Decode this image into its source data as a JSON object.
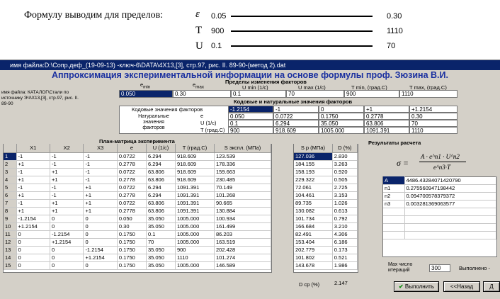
{
  "heading": "Формулу выводим для пределов:",
  "limits": [
    {
      "sym": "ε",
      "min": "0.05",
      "max": "0.30"
    },
    {
      "sym": "T",
      "min": "900",
      "max": "1110"
    },
    {
      "sym": "U",
      "min": "0.1",
      "max": "70"
    }
  ],
  "window": {
    "title": "имя файла:D:\\Сопр.деф_(19-09-13) -ключ-6\\DATA\\4X13,[3], стр.97, рис. II. 89-90-(метод 2).dat",
    "app_title": "Аппроксимация экспериментальной информации на основе формулы проф. Зюзина В.И.",
    "file_label": "имя файла: КАТАЛОГ\\Стали по источнику ЭЧ\\Х13,[3], стр.97, рис. II. 89-90",
    "limits_section": {
      "title": "Пределы изменения факторов",
      "headers": [
        "e min",
        "e max",
        "U min (1/c)",
        "U max (1/c)",
        "T min, (град.С)",
        "T max, (град.С)"
      ],
      "e_min_label": "e",
      "e_min_sub": "min",
      "e_max_label": "e",
      "e_max_sub": "max",
      "u_min_label": "U min (1/c)",
      "u_max_label": "U max (1/c)",
      "t_min_label": "T min, (град.С)",
      "t_max_label": "T max, (град.С)",
      "values": [
        "0.050",
        "0.30",
        "0.1",
        "70",
        "900",
        "1110"
      ]
    },
    "codes_section": {
      "title": "Кодовые и натуральные значения факторов",
      "code_label": "Кодовые значения факторов",
      "codes": [
        "-1.2154",
        "-1",
        "0",
        "+1",
        "+1.2154"
      ],
      "natural_label": "Натуральные значения факторов",
      "rows": [
        {
          "name": "e",
          "vals": [
            "0.050",
            "0.0722",
            "0.1750",
            "0.2778",
            "0.30"
          ]
        },
        {
          "name": "U (1/c)",
          "vals": [
            "0.1",
            "6.294",
            "35.050",
            "63.806",
            "70"
          ]
        },
        {
          "name": "T (град.С)",
          "vals": [
            "900",
            "918.609",
            "1005.000",
            "1091.391",
            "1110"
          ]
        }
      ]
    },
    "plan": {
      "title": "План-матрица эксперимента",
      "headers": [
        "",
        "X1",
        "X2",
        "X3",
        "e",
        "U (1/c)",
        "T (град.С)",
        "S экспл. (МПа)"
      ],
      "rows": [
        [
          "1",
          "-1",
          "-1",
          "-1",
          "0.0722",
          "6.294",
          "918.609",
          "123.539"
        ],
        [
          "2",
          "+1",
          "-1",
          "-1",
          "0.2778",
          "6.294",
          "918.609",
          "178.336"
        ],
        [
          "3",
          "-1",
          "+1",
          "-1",
          "0.0722",
          "63.806",
          "918.609",
          "159.663"
        ],
        [
          "4",
          "+1",
          "+1",
          "-1",
          "0.2778",
          "63.806",
          "918.609",
          "230.485"
        ],
        [
          "5",
          "-1",
          "-1",
          "+1",
          "0.0722",
          "6.294",
          "1091.391",
          "70.149"
        ],
        [
          "6",
          "+1",
          "-1",
          "+1",
          "0.2778",
          "6.294",
          "1091.391",
          "101.268"
        ],
        [
          "7",
          "-1",
          "+1",
          "+1",
          "0.0722",
          "63.806",
          "1091.391",
          "90.665"
        ],
        [
          "8",
          "+1",
          "+1",
          "+1",
          "0.2778",
          "63.806",
          "1091.391",
          "130.884"
        ],
        [
          "9",
          "-1.2154",
          "0",
          "0",
          "0.050",
          "35.050",
          "1005.000",
          "100.934"
        ],
        [
          "10",
          "+1.2154",
          "0",
          "0",
          "0.30",
          "35.050",
          "1005.000",
          "161.499"
        ],
        [
          "11",
          "0",
          "-1.2154",
          "0",
          "0.1750",
          "0.1",
          "1005.000",
          "86.203"
        ],
        [
          "12",
          "0",
          "+1.2154",
          "0",
          "0.1750",
          "70",
          "1005.000",
          "163.519"
        ],
        [
          "13",
          "0",
          "0",
          "-1.2154",
          "0.1750",
          "35.050",
          "900",
          "202.428"
        ],
        [
          "14",
          "0",
          "0",
          "+1.2154",
          "0.1750",
          "35.050",
          "1110",
          "101.274"
        ],
        [
          "15",
          "0",
          "0",
          "0",
          "0.1750",
          "35.050",
          "1005.000",
          "146.589"
        ]
      ]
    },
    "sp_table": {
      "headers": [
        "S p (МПа)",
        "D (%)"
      ],
      "rows": [
        [
          "127.036",
          "2.830"
        ],
        [
          "184.155",
          "3.263"
        ],
        [
          "158.193",
          "0.920"
        ],
        [
          "229.322",
          "0.505"
        ],
        [
          "72.061",
          "2.725"
        ],
        [
          "104.461",
          "3.153"
        ],
        [
          "89.735",
          "1.026"
        ],
        [
          "130.082",
          "0.613"
        ],
        [
          "101.734",
          "0.792"
        ],
        [
          "166.684",
          "3.210"
        ],
        [
          "82.491",
          "4.306"
        ],
        [
          "153.404",
          "6.186"
        ],
        [
          "202.779",
          "0.173"
        ],
        [
          "101.802",
          "0.521"
        ],
        [
          "143.678",
          "1.986"
        ]
      ],
      "dcp_label": "D ср (%)",
      "dcp_value": "2.147"
    },
    "results": {
      "title": "Результаты расчета",
      "formula_lhs": "σ =",
      "formula_num": "A · e^n1 · U^n2",
      "formula_den": "e^n3·T",
      "rows": [
        {
          "name": "A",
          "value": "4486.43284071420790"
        },
        {
          "name": "n1",
          "value": "0.275560947198442"
        },
        {
          "name": "n2",
          "value": "0.094700578379372"
        },
        {
          "name": "n3",
          "value": "0.003281369063577"
        }
      ]
    },
    "iter": {
      "label": "Мах число итераций",
      "value": "300",
      "status": "Выполнено -"
    },
    "buttons": {
      "run": "Выполнить",
      "back": "<<Назад",
      "next": "Д"
    }
  }
}
